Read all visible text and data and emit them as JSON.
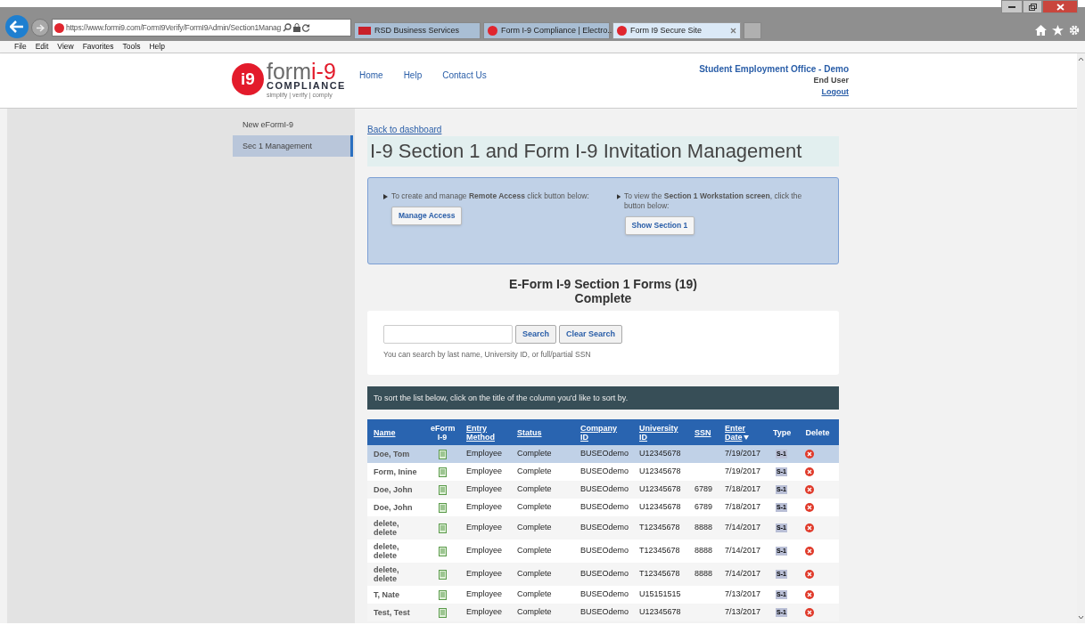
{
  "browser": {
    "url": "https://www.formi9.com/FormI9Verify/FormI9Admin/Section1Manag",
    "tabs": [
      {
        "label": "RSD Business Services",
        "selected": false,
        "kind": "rsd"
      },
      {
        "label": "Form I-9 Compliance | Electro...",
        "selected": false,
        "kind": "i9"
      },
      {
        "label": "Form I9 Secure Site",
        "selected": true,
        "kind": "i9"
      }
    ],
    "menu": [
      "File",
      "Edit",
      "View",
      "Favorites",
      "Tools",
      "Help"
    ]
  },
  "header": {
    "logo_word": "form",
    "logo_accent": "i-9",
    "logo_sub": "COMPLIANCE",
    "logo_tagline": "simplify | verify | comply",
    "logo_badge": "i9",
    "nav": [
      "Home",
      "Help",
      "Contact Us"
    ],
    "org": "Student Employment Office - Demo",
    "role": "End User",
    "logout": "Logout"
  },
  "sidebar": {
    "items": [
      {
        "label": "New eFormI-9",
        "selected": false
      },
      {
        "label": "Sec 1 Management",
        "selected": true
      }
    ]
  },
  "back_link": "Back to dashboard",
  "title": "I-9 Section 1 and Form I-9 Invitation Management",
  "info_panel": [
    {
      "text": "To create and manage **Remote Access** click button below:",
      "button": "Manage Access"
    },
    {
      "text": "To view the **Section 1 Workstation screen**, click the button below:",
      "button": "Show Section 1"
    }
  ],
  "forms_heading": [
    "E-Form I-9 Section 1 Forms (19)",
    "Complete"
  ],
  "search": {
    "button": "Search",
    "clear": "Clear Search",
    "hint": "You can search by last name, University ID, or full/partial SSN"
  },
  "sort_hint": "To sort the list below, click on the title of the column you'd like to sort by.",
  "table": {
    "columns": [
      {
        "label": "Name",
        "sortable": true
      },
      {
        "label": "eForm I-9",
        "sortable": false
      },
      {
        "label": "Entry Method",
        "sortable": true
      },
      {
        "label": "Status",
        "sortable": true
      },
      {
        "label": "Company ID",
        "sortable": true
      },
      {
        "label": "University ID",
        "sortable": true
      },
      {
        "label": "SSN",
        "sortable": true
      },
      {
        "label": "Enter Date",
        "sortable": true,
        "sorted": true
      },
      {
        "label": "Type",
        "sortable": false
      },
      {
        "label": "Delete",
        "sortable": false
      }
    ],
    "rows": [
      {
        "name": "Doe, Tom",
        "entry": "Employee",
        "status": "Complete",
        "company": "BUSEOdemo",
        "university": "U12345678",
        "ssn": "",
        "date": "7/19/2017",
        "type": "S-1",
        "selected": true
      },
      {
        "name": "Form, Inine",
        "entry": "Employee",
        "status": "Complete",
        "company": "BUSEOdemo",
        "university": "U12345678",
        "ssn": "",
        "date": "7/19/2017",
        "type": "S-1",
        "selected": false
      },
      {
        "name": "Doe, John",
        "entry": "Employee",
        "status": "Complete",
        "company": "BUSEOdemo",
        "university": "U12345678",
        "ssn": "6789",
        "date": "7/18/2017",
        "type": "S-1",
        "selected": false
      },
      {
        "name": "Doe, John",
        "entry": "Employee",
        "status": "Complete",
        "company": "BUSEOdemo",
        "university": "U12345678",
        "ssn": "6789",
        "date": "7/18/2017",
        "type": "S-1",
        "selected": false
      },
      {
        "name": "delete, delete",
        "entry": "Employee",
        "status": "Complete",
        "company": "BUSEOdemo",
        "university": "T12345678",
        "ssn": "8888",
        "date": "7/14/2017",
        "type": "S-1",
        "selected": false
      },
      {
        "name": "delete, delete",
        "entry": "Employee",
        "status": "Complete",
        "company": "BUSEOdemo",
        "university": "T12345678",
        "ssn": "8888",
        "date": "7/14/2017",
        "type": "S-1",
        "selected": false
      },
      {
        "name": "delete, delete",
        "entry": "Employee",
        "status": "Complete",
        "company": "BUSEOdemo",
        "university": "T12345678",
        "ssn": "8888",
        "date": "7/14/2017",
        "type": "S-1",
        "selected": false
      },
      {
        "name": "T, Nate",
        "entry": "Employee",
        "status": "Complete",
        "company": "BUSEOdemo",
        "university": "U15151515",
        "ssn": "",
        "date": "7/13/2017",
        "type": "S-1",
        "selected": false
      },
      {
        "name": "Test, Test",
        "entry": "Employee",
        "status": "Complete",
        "company": "BUSEOdemo",
        "university": "U12345678",
        "ssn": "",
        "date": "7/13/2017",
        "type": "S-1",
        "selected": false
      }
    ]
  }
}
